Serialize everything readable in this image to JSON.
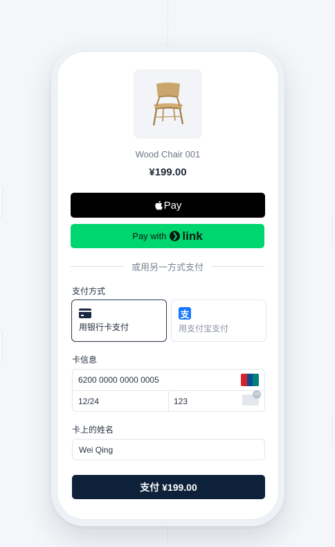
{
  "product": {
    "name": "Wood Chair 001",
    "price": "¥199.00",
    "image_icon": "wooden-chair"
  },
  "express": {
    "apple_pay_label": "Pay",
    "link_prefix": "Pay with",
    "link_brand": "link"
  },
  "divider_text": "或用另一方式支付",
  "payment_method": {
    "label": "支付方式",
    "options": [
      {
        "label": "用银行卡支付",
        "icon": "credit-card-icon",
        "selected": true
      },
      {
        "label": "用支付宝支付",
        "icon": "alipay-icon",
        "selected": false
      }
    ]
  },
  "card_info": {
    "label": "卡信息",
    "number": "6200 0000 0000 0005",
    "expiry": "12/24",
    "cvc": "123",
    "brand_icon": "unionpay-icon"
  },
  "cardholder": {
    "label": "卡上的姓名",
    "value": "Wei Qing"
  },
  "pay_button": "支付 ¥199.00",
  "colors": {
    "link_green": "#00d66f",
    "pay_button": "#0d213a",
    "alipay_blue": "#1677ff"
  }
}
